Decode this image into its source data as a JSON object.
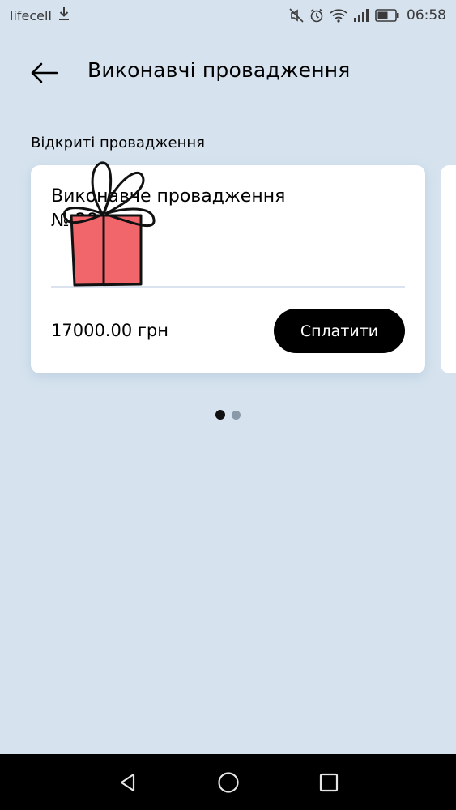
{
  "status_bar": {
    "carrier": "lifecell",
    "time": "06:58",
    "icons": [
      "download-icon",
      "mute-icon",
      "alarm-icon",
      "wifi-icon",
      "signal-icon",
      "battery-icon"
    ]
  },
  "header": {
    "title": "Виконавчі провадження",
    "back_icon": "arrow-left-icon"
  },
  "section": {
    "title": "Відкриті провадження"
  },
  "cards": [
    {
      "title_line1": "Виконавче провадження",
      "title_line2": "№ 28",
      "amount": "17000.00 грн",
      "pay_label": "Сплатити"
    }
  ],
  "pagination": {
    "total": 2,
    "active": 0
  },
  "nav_bar": {
    "icons": [
      "back-triangle-icon",
      "home-circle-icon",
      "recents-square-icon"
    ]
  },
  "colors": {
    "background": "#d6e3ef",
    "card": "#ffffff",
    "button": "#000000",
    "gift_box": "#f0666a"
  }
}
